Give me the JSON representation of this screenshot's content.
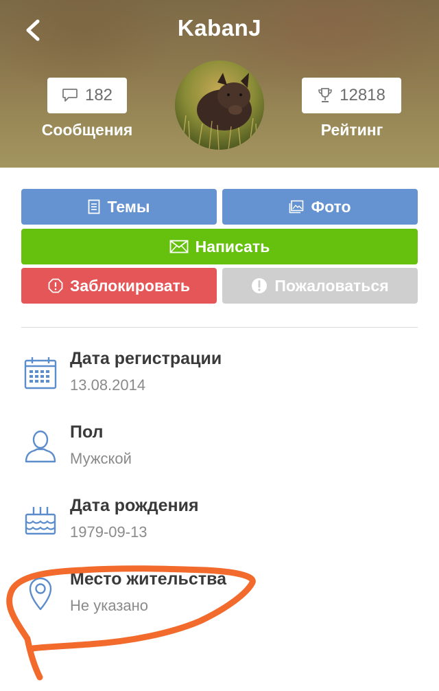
{
  "header": {
    "title": "KabanJ",
    "back_icon": "chevron-left-icon",
    "messages": {
      "count": "182",
      "label": "Сообщения",
      "icon": "speech-bubble-icon"
    },
    "rating": {
      "count": "12818",
      "label": "Рейтинг",
      "icon": "trophy-icon"
    },
    "avatar_icon": "boar-avatar"
  },
  "actions": {
    "topics": {
      "label": "Темы",
      "icon": "document-icon"
    },
    "photo": {
      "label": "Фото",
      "icon": "image-icon"
    },
    "write": {
      "label": "Написать",
      "icon": "envelope-icon"
    },
    "block": {
      "label": "Заблокировать",
      "icon": "hexagon-alert-icon"
    },
    "report": {
      "label": "Пожаловаться",
      "icon": "exclamation-circle-icon"
    }
  },
  "info": {
    "registration": {
      "label": "Дата регистрации",
      "value": "13.08.2014",
      "icon": "calendar-icon"
    },
    "gender": {
      "label": "Пол",
      "value": "Мужской",
      "icon": "user-icon"
    },
    "birthday": {
      "label": "Дата рождения",
      "value": "1979-09-13",
      "icon": "cake-icon"
    },
    "location": {
      "label": "Место жительства",
      "value": "Не указано",
      "icon": "map-pin-icon"
    }
  },
  "colors": {
    "button_blue": "#6592d0",
    "button_green": "#66c10f",
    "button_red": "#e45657",
    "button_gray": "#cfcfcf",
    "icon_blue": "#5b8ccb",
    "annotation_orange": "#f26b2d"
  }
}
